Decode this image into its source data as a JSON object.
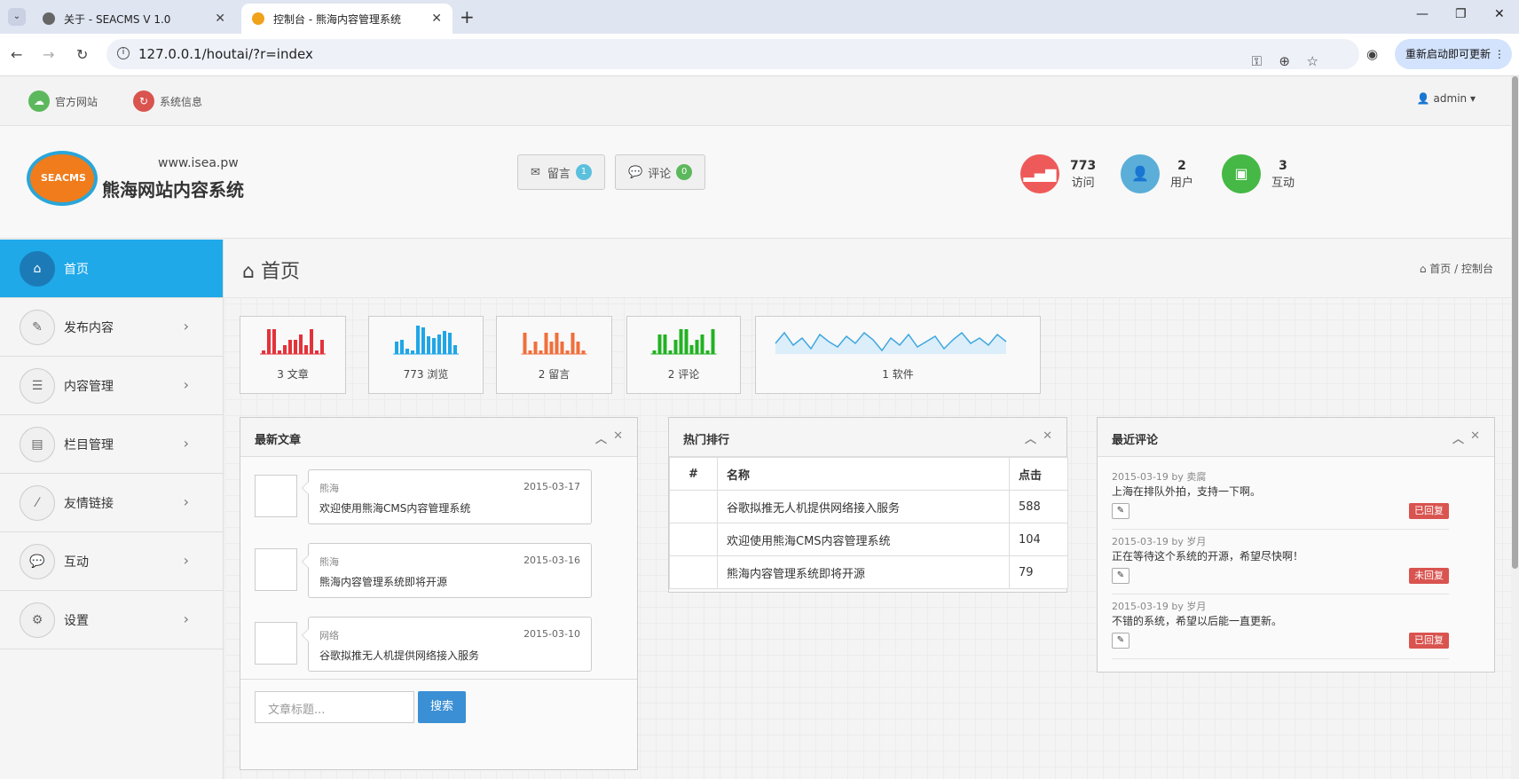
{
  "browser": {
    "tabs": [
      {
        "title": "关于 - SEACMS V 1.0"
      },
      {
        "title": "控制台 - 熊海内容管理系统"
      }
    ],
    "url": "127.0.0.1/houtai/?r=index",
    "restart_label": "重新启动即可更新"
  },
  "topnav": {
    "official": "官方网站",
    "sysinfo": "系统信息",
    "user": "admin"
  },
  "header": {
    "logo_badge": "SEACMS",
    "logo_url": "www.isea.pw",
    "logo_name": "熊海网站内容系统",
    "msg_label": "留言",
    "msg_count": "1",
    "comment_label": "评论",
    "comment_count": "0",
    "stats": [
      {
        "value": "773",
        "label": "访问"
      },
      {
        "value": "2",
        "label": "用户"
      },
      {
        "value": "3",
        "label": "互动"
      }
    ]
  },
  "sidebar": {
    "items": [
      {
        "label": "首页",
        "icon": "home-icon"
      },
      {
        "label": "发布内容",
        "icon": "pencil-icon"
      },
      {
        "label": "内容管理",
        "icon": "list-icon"
      },
      {
        "label": "栏目管理",
        "icon": "columns-icon"
      },
      {
        "label": "友情链接",
        "icon": "wand-icon"
      },
      {
        "label": "互动",
        "icon": "chat-icon"
      },
      {
        "label": "设置",
        "icon": "gears-icon"
      }
    ]
  },
  "main": {
    "page_title": "首页",
    "breadcrumb": [
      "首页",
      "控制台"
    ],
    "mini_stats": [
      {
        "label": "3 文章",
        "color": "#e3323a"
      },
      {
        "label": "773 浏览",
        "color": "#20a6e6"
      },
      {
        "label": "2 留言",
        "color": "#f06f3c"
      },
      {
        "label": "2 评论",
        "color": "#22b222"
      },
      {
        "label": "1 软件",
        "color": "#3ea7e0"
      }
    ],
    "articles": {
      "title": "最新文章",
      "items": [
        {
          "author": "熊海",
          "date": "2015-03-17",
          "title": "欢迎使用熊海CMS内容管理系统"
        },
        {
          "author": "熊海",
          "date": "2015-03-16",
          "title": "熊海内容管理系统即将开源"
        },
        {
          "author": "网络",
          "date": "2015-03-10",
          "title": "谷歌拟推无人机提供网络接入服务"
        }
      ],
      "search_placeholder": "文章标题...",
      "search_button": "搜索"
    },
    "hot": {
      "title": "热门排行",
      "headers": [
        "#",
        "名称",
        "点击"
      ],
      "rows": [
        {
          "num": "",
          "name": "谷歌拟推无人机提供网络接入服务",
          "clicks": "588"
        },
        {
          "num": "",
          "name": "欢迎使用熊海CMS内容管理系统",
          "clicks": "104"
        },
        {
          "num": "",
          "name": "熊海内容管理系统即将开源",
          "clicks": "79"
        }
      ]
    },
    "comments": {
      "title": "最近评论",
      "items": [
        {
          "meta": "2015-03-19 by 卖腐",
          "text": "上海在排队外拍，支持一下啊。",
          "status": "已回复"
        },
        {
          "meta": "2015-03-19 by 岁月",
          "text": "正在等待这个系统的开源，希望尽快啊！",
          "status": "未回复"
        },
        {
          "meta": "2015-03-19 by 岁月",
          "text": "不错的系统，希望以后能一直更新。",
          "status": "已回复"
        }
      ]
    }
  }
}
